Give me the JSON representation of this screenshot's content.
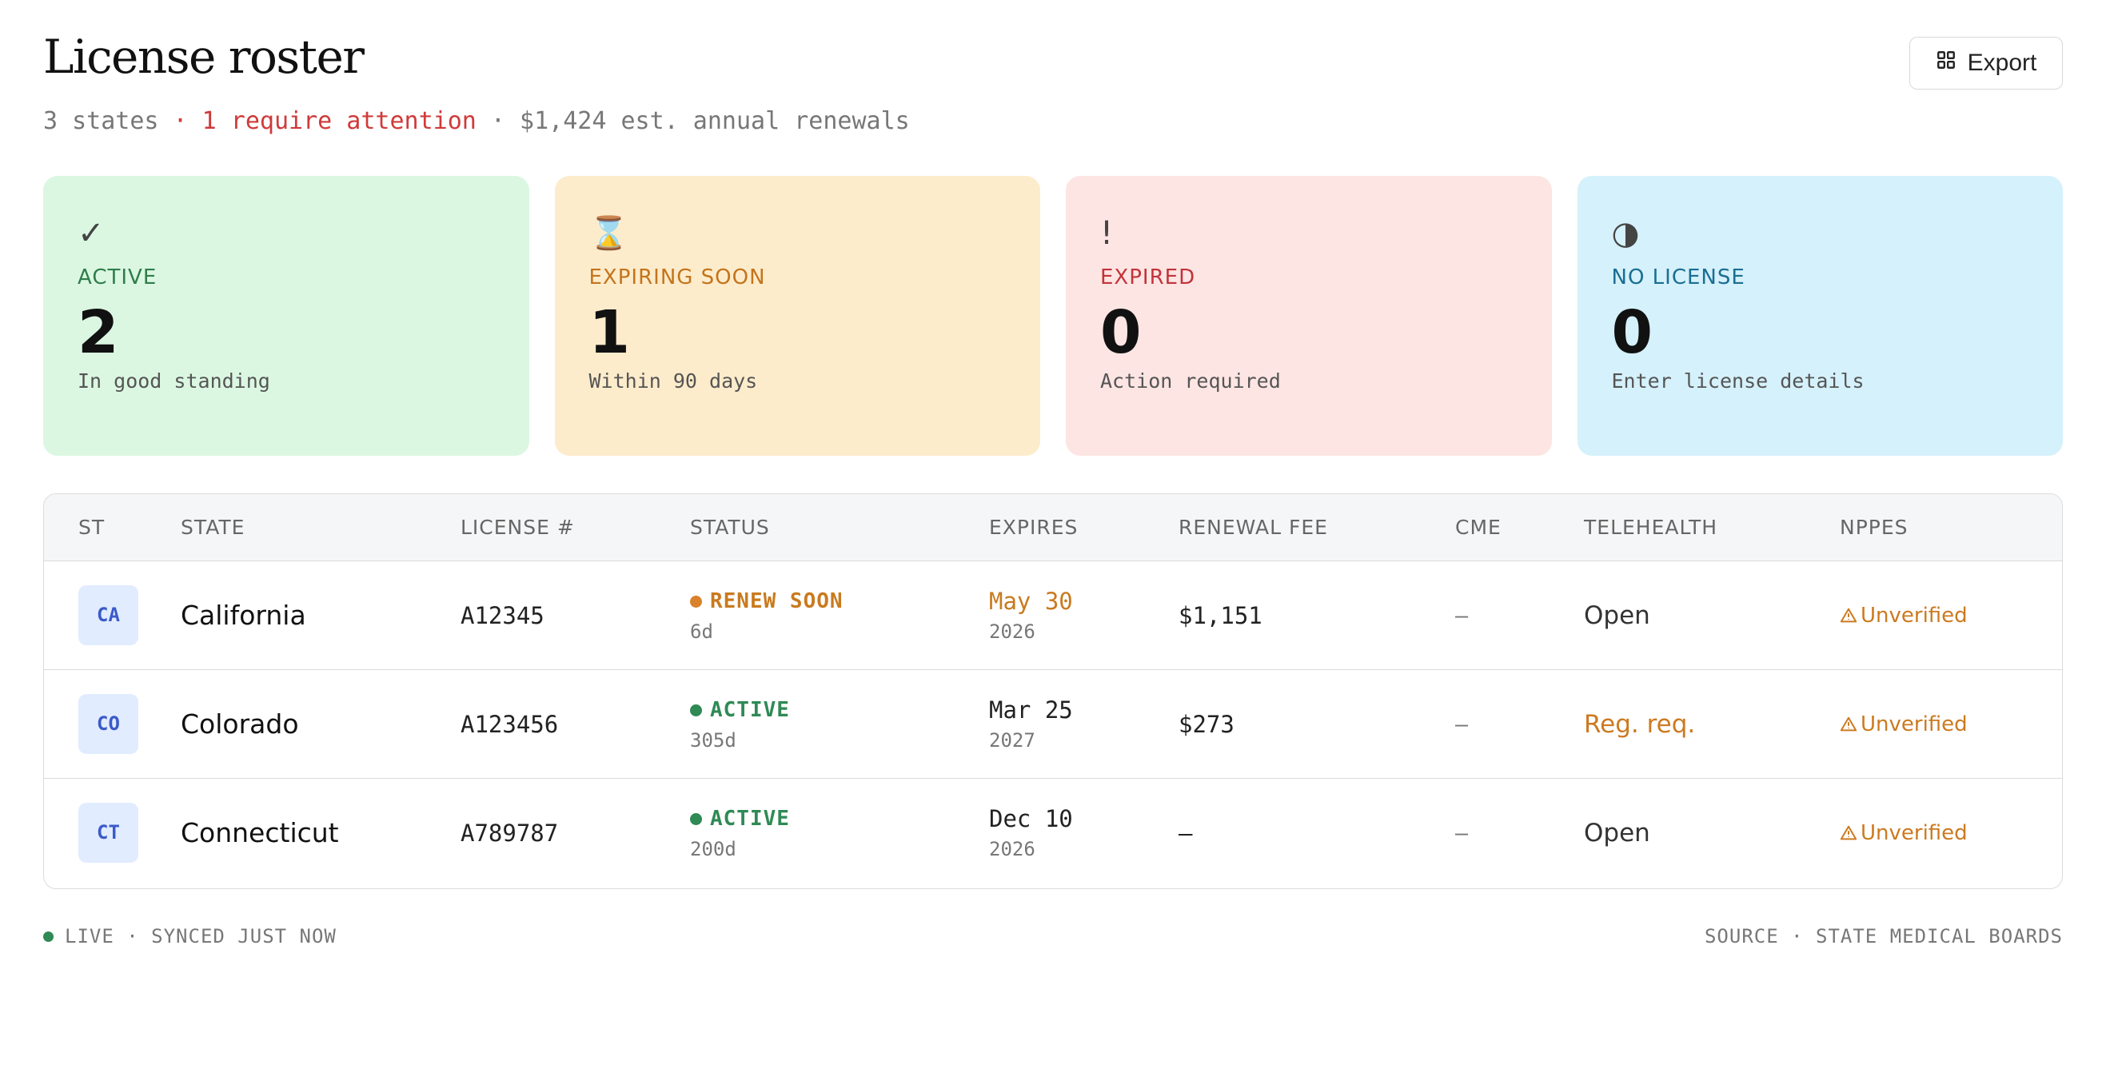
{
  "header": {
    "title": "License roster",
    "subtitle_states": "3 states",
    "subtitle_attention": " · 1 require attention",
    "subtitle_renewals": " · $1,424 est. annual renewals",
    "export_label": "Export"
  },
  "cards": [
    {
      "icon": "✓",
      "label": "ACTIVE",
      "count": "2",
      "desc": "In good standing"
    },
    {
      "icon": "⌛",
      "label": "EXPIRING SOON",
      "count": "1",
      "desc": "Within 90 days"
    },
    {
      "icon": "!",
      "label": "EXPIRED",
      "count": "0",
      "desc": "Action required"
    },
    {
      "icon": "◑",
      "label": "NO LICENSE",
      "count": "0",
      "desc": "Enter license details"
    }
  ],
  "table": {
    "columns": [
      "ST",
      "STATE",
      "LICENSE #",
      "STATUS",
      "EXPIRES",
      "RENEWAL FEE",
      "CME",
      "TELEHEALTH",
      "NPPES"
    ],
    "rows": [
      {
        "st": "CA",
        "state": "California",
        "license": "A12345",
        "status": "RENEW SOON",
        "status_days": "6d",
        "expires_date": "May 30",
        "expires_year": "2026",
        "fee": "$1,151",
        "cme": "–",
        "telehealth": "Open",
        "nppes": "Unverified"
      },
      {
        "st": "CO",
        "state": "Colorado",
        "license": "A123456",
        "status": "ACTIVE",
        "status_days": "305d",
        "expires_date": "Mar 25",
        "expires_year": "2027",
        "fee": "$273",
        "cme": "–",
        "telehealth": "Reg. req.",
        "nppes": "Unverified"
      },
      {
        "st": "CT",
        "state": "Connecticut",
        "license": "A789787",
        "status": "ACTIVE",
        "status_days": "200d",
        "expires_date": "Dec 10",
        "expires_year": "2026",
        "fee": "–",
        "cme": "–",
        "telehealth": "Open",
        "nppes": "Unverified"
      }
    ]
  },
  "footer": {
    "left": "LIVE · SYNCED JUST NOW",
    "right": "SOURCE · STATE MEDICAL BOARDS"
  },
  "colors": {
    "renew_soon": "#c97a1e",
    "active": "#2f8a55",
    "attention": "#d03a3a",
    "reg_req": "#cc7a20"
  }
}
